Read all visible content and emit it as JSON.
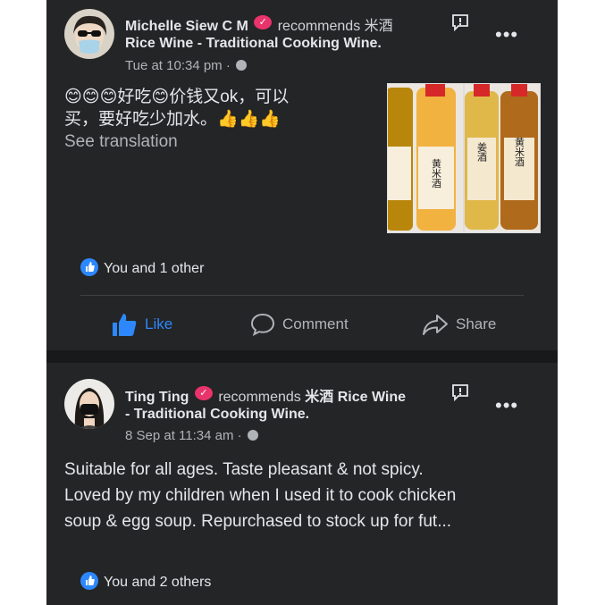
{
  "posts": [
    {
      "user": "Michelle Siew C M",
      "recommends_label": "recommends",
      "page_name_line1": "米酒",
      "page_name_line2": "Rice Wine - Traditional Cooking Wine.",
      "time": "Tue at 10:34 pm",
      "text_line1": "😊😊😊好吃😊价钱又ok，可以",
      "text_line2": "买，要好吃少加水。👍👍👍",
      "translation_link": "See translation",
      "reactions": "You and 1 other",
      "actions": {
        "like": "Like",
        "comment": "Comment",
        "share": "Share"
      },
      "photos": [
        "黄米酒",
        "姜酒",
        "黄米酒"
      ]
    },
    {
      "user": "Ting Ting",
      "recommends_label": "recommends",
      "page_name_line1": "米酒 Rice Wine",
      "page_name_line2": "- Traditional Cooking Wine.",
      "time": "8 Sep at 11:34 am",
      "text_line1": "Suitable for all ages. Taste pleasant & not spicy.",
      "text_line2": "Loved by my children when I used it to cook chicken",
      "text_line3": "soup & egg soup. Repurchased to stock up for fut...",
      "reactions": "You and 2 others"
    }
  ],
  "colors": {
    "background": "#242526",
    "separator": "#18191a",
    "text": "#e4e6eb",
    "muted": "#b0b3b8",
    "accent": "#2d88ff",
    "recommend_badge": "#e8336b"
  }
}
